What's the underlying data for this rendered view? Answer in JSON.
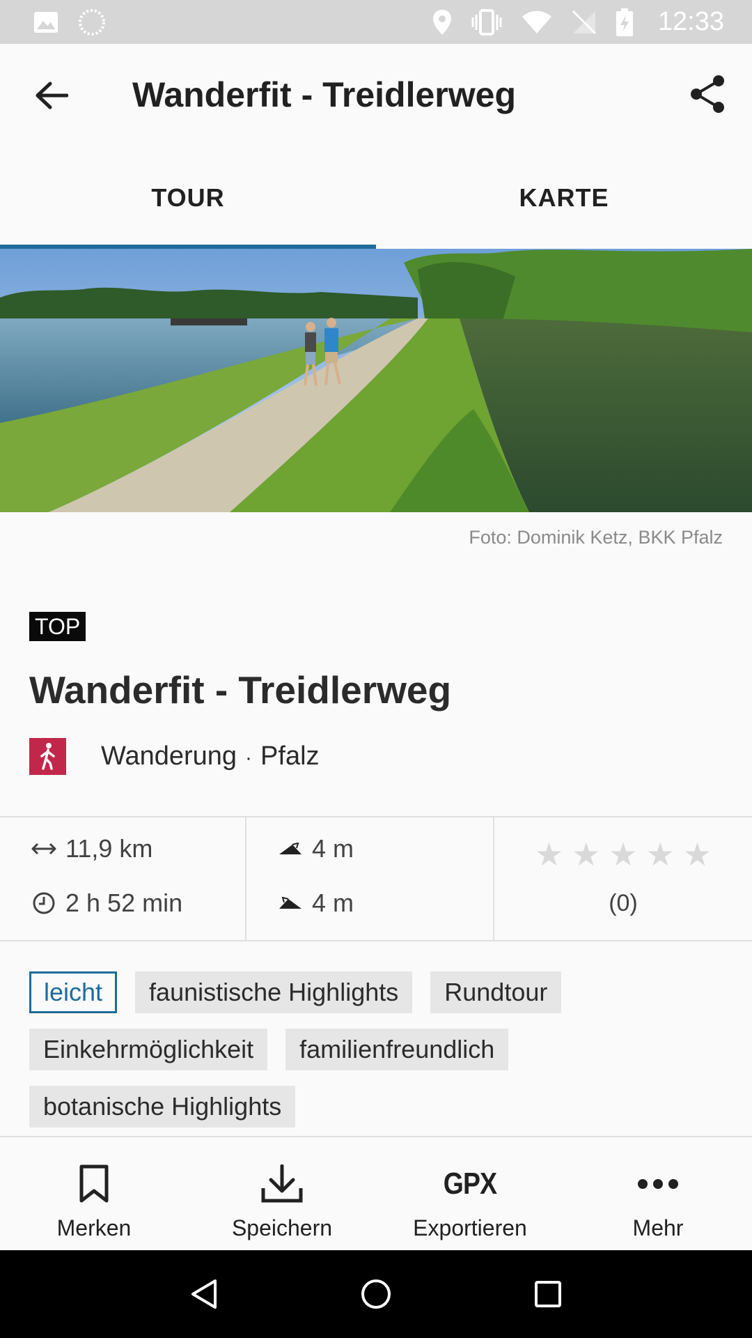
{
  "status_bar": {
    "time": "12:33",
    "icons": [
      "image-icon",
      "loading-icon",
      "location-icon",
      "vibrate-icon",
      "wifi-icon",
      "no-sim-icon",
      "battery-icon"
    ]
  },
  "app_bar": {
    "title": "Wanderfit - Treidlerweg",
    "back_icon": "arrow-left-icon",
    "share_icon": "share-icon"
  },
  "tabs": [
    {
      "label": "TOUR",
      "active": true
    },
    {
      "label": "KARTE",
      "active": false
    }
  ],
  "hero": {
    "caption": "Foto: Dominik Ketz, BKK Pfalz"
  },
  "tour": {
    "badge": "TOP",
    "title": "Wanderfit - Treidlerweg",
    "category": "Wanderung",
    "separator": "·",
    "region": "Pfalz",
    "category_color": "#c1274a"
  },
  "stats": {
    "distance": "11,9 km",
    "duration": "2 h 52 min",
    "ascent": "4 m",
    "descent": "4 m",
    "rating_stars": 0,
    "rating_max": 5,
    "rating_count": "(0)"
  },
  "tags": {
    "level": "leicht",
    "items": [
      "faunistische Highlights",
      "Rundtour",
      "Einkehrmöglichkeit",
      "familienfreundlich",
      "botanische Highlights"
    ]
  },
  "actions": [
    {
      "label": "Merken",
      "icon": "bookmark-icon"
    },
    {
      "label": "Speichern",
      "icon": "download-icon"
    },
    {
      "label": "Exportieren",
      "icon": "gpx-icon",
      "icon_text": "GPX"
    },
    {
      "label": "Mehr",
      "icon": "more-dots-icon"
    }
  ],
  "colors": {
    "accent": "#1f6b9a",
    "status_bar": "#d6d6d6",
    "nav_bar": "#000000"
  }
}
